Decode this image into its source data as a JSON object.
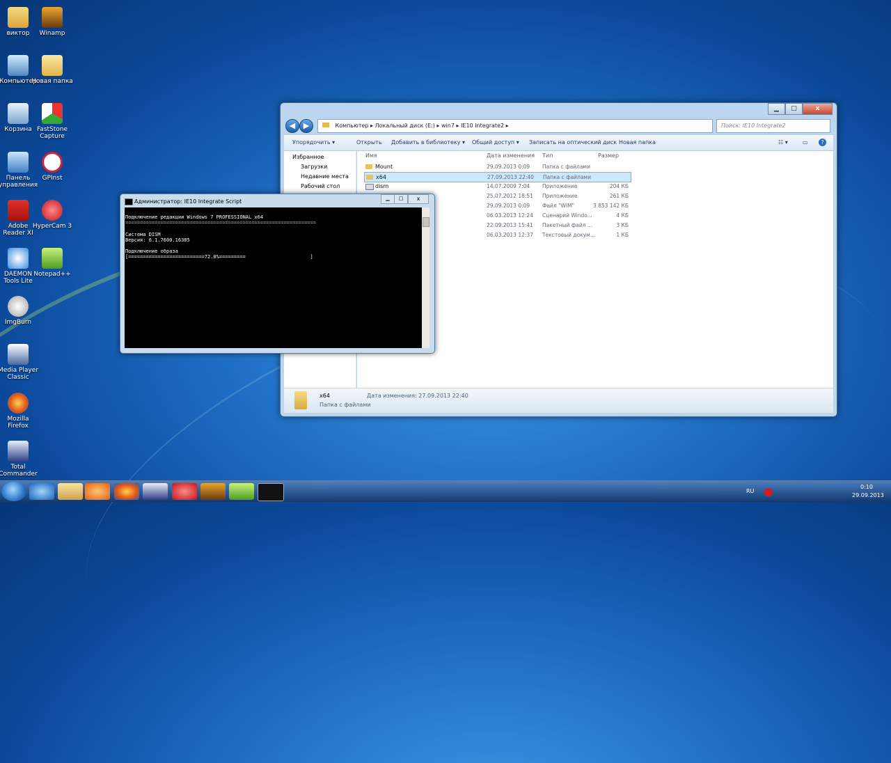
{
  "desktop": {
    "icons": [
      {
        "label": "виктор",
        "icon": "folder-user-icon"
      },
      {
        "label": "Winamp",
        "icon": "winamp-icon"
      },
      {
        "label": "Компьютер",
        "icon": "computer-icon"
      },
      {
        "label": "Новая папка",
        "icon": "folder-icon"
      },
      {
        "label": "Корзина",
        "icon": "recycle-bin-icon"
      },
      {
        "label": "FastStone Capture",
        "icon": "faststone-icon"
      },
      {
        "label": "Панель управления",
        "icon": "control-panel-icon"
      },
      {
        "label": "GPInst",
        "icon": "gpinst-icon"
      },
      {
        "label": "Adobe Reader XI",
        "icon": "adobe-reader-icon"
      },
      {
        "label": "HyperCam 3",
        "icon": "hypercam-icon"
      },
      {
        "label": "DAEMON Tools Lite",
        "icon": "daemon-tools-icon"
      },
      {
        "label": "Notepad++",
        "icon": "notepad-plus-icon"
      },
      {
        "label": "ImgBurn",
        "icon": "imgburn-icon"
      },
      {
        "label": "Media Player Classic",
        "icon": "media-player-classic-icon"
      },
      {
        "label": "Mozilla Firefox",
        "icon": "firefox-icon"
      },
      {
        "label": "Total Commander",
        "icon": "total-commander-icon"
      }
    ]
  },
  "explorer": {
    "window_buttons": {
      "min": "▁",
      "max": "□",
      "close": "x"
    },
    "address": {
      "parts": [
        "Компьютер",
        "Локальный диск (E:)",
        "win7",
        "IE10 Integrate2"
      ]
    },
    "search_placeholder": "Поиск: IE10 Integrate2",
    "toolbar": {
      "organize": "Упорядочить ▾",
      "open": "Открыть",
      "add_library": "Добавить в библиотеку ▾",
      "share": "Общий доступ ▾",
      "burn": "Записать на оптический диск",
      "new_folder": "Новая папка"
    },
    "nav": {
      "favorites": "Избранное",
      "downloads": "Загрузки",
      "recent": "Недавние места",
      "desktop": "Рабочий стол"
    },
    "columns": {
      "name": "Имя",
      "date": "Дата изменения",
      "type": "Тип",
      "size": "Размер"
    },
    "rows": [
      {
        "name": "Mount",
        "date": "29.09.2013 0:09",
        "type": "Папка с файлами",
        "size": ""
      },
      {
        "name": "x64",
        "date": "27.09.2013 22:40",
        "type": "Папка с файлами",
        "size": ""
      },
      {
        "name": "dism",
        "date": "14.07.2009 7:04",
        "type": "Приложение",
        "size": "204 КБ"
      },
      {
        "name": "",
        "date": "25.07.2012 18:51",
        "type": "Приложение",
        "size": "261 КБ"
      },
      {
        "name": "",
        "date": "29.09.2013 0:09",
        "type": "Файл \"WIM\"",
        "size": "3 853 142 КБ"
      },
      {
        "name": "",
        "date": "06.03.2013 12:24",
        "type": "Сценарий Windo...",
        "size": "4 КБ"
      },
      {
        "name": "",
        "date": "22.09.2013 15:41",
        "type": "Пакетный файл ...",
        "size": "3 КБ"
      },
      {
        "name": "",
        "date": "06.03.2013 12:37",
        "type": "Текстовый докум...",
        "size": "1 КБ"
      }
    ],
    "details": {
      "name": "x64",
      "kind": "Папка с файлами",
      "modified": "Дата изменения: 27.09.2013 22:40"
    }
  },
  "console": {
    "title": "Администратор:  IE10 Integrate Script",
    "lines": [
      "Подключение редакции Windows 7 PROFESSIONAL x64",
      "=================================================================",
      "",
      "Система DISM",
      "Версия: 6.1.7600.16385",
      "",
      "Подключение образа",
      "[==========================72.0%=========                      ]"
    ]
  },
  "taskbar": {
    "items": [
      "ie-icon",
      "explorer-icon",
      "media-player-icon",
      "firefox-icon",
      "total-commander-icon",
      "hypercam-icon",
      "winamp-icon",
      "notepad-plus-icon",
      "cmd-icon"
    ],
    "lang": "RU",
    "time": "0:10",
    "date": "29.09.2013"
  }
}
